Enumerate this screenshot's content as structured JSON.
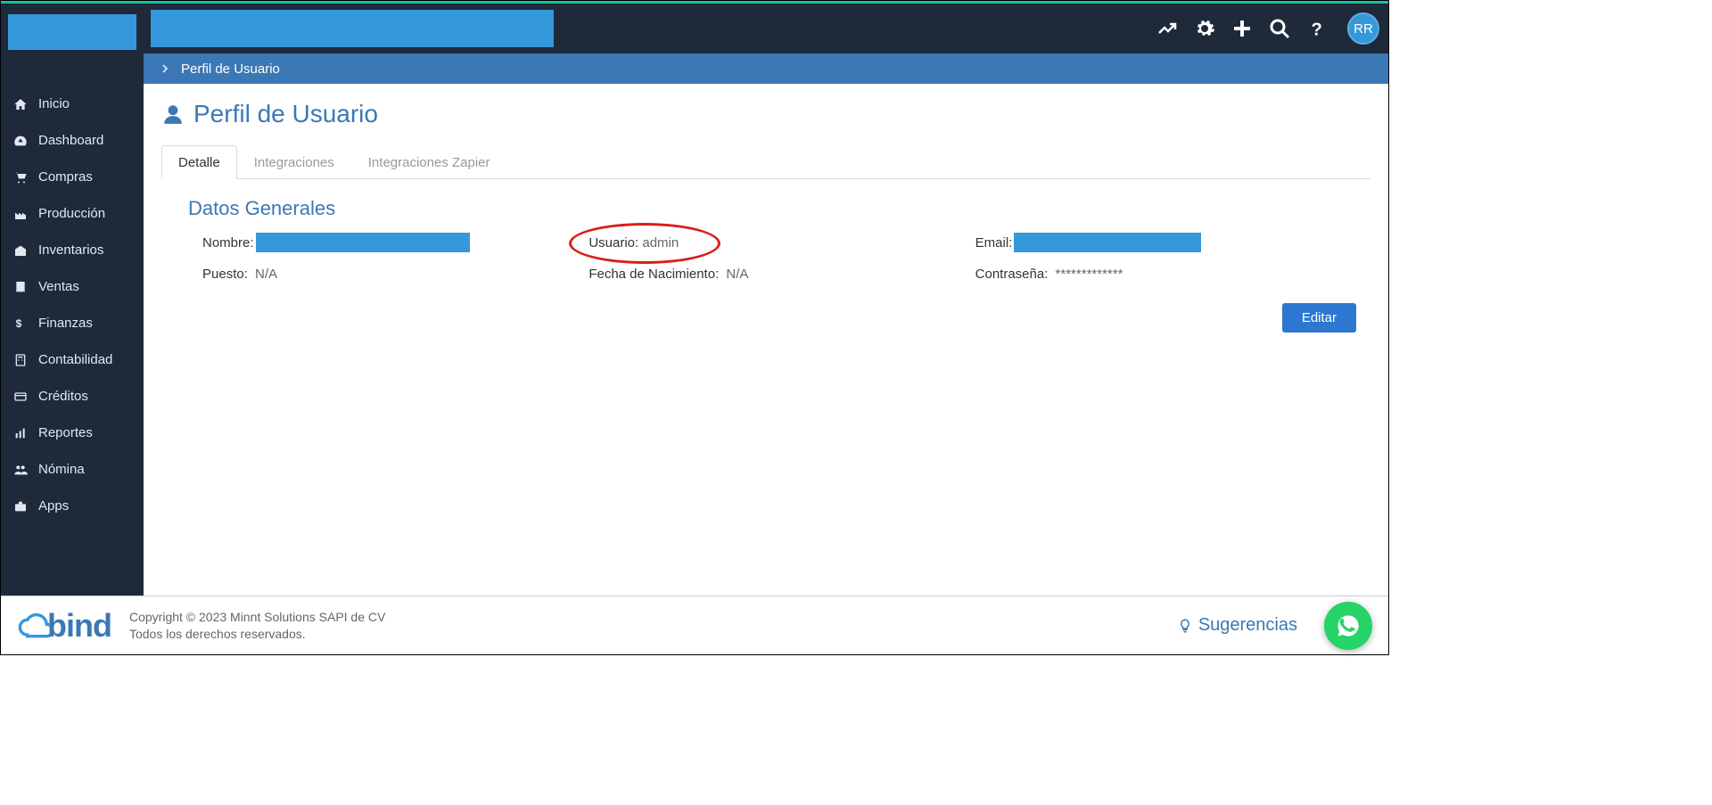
{
  "sidebar": {
    "items": [
      {
        "label": "Inicio"
      },
      {
        "label": "Dashboard"
      },
      {
        "label": "Compras"
      },
      {
        "label": "Producción"
      },
      {
        "label": "Inventarios"
      },
      {
        "label": "Ventas"
      },
      {
        "label": "Finanzas"
      },
      {
        "label": "Contabilidad"
      },
      {
        "label": "Créditos"
      },
      {
        "label": "Reportes"
      },
      {
        "label": "Nómina"
      },
      {
        "label": "Apps"
      }
    ]
  },
  "header": {
    "avatar_initials": "RR"
  },
  "breadcrumb": {
    "current": "Perfil de Usuario"
  },
  "page": {
    "title": "Perfil de Usuario",
    "section_title": "Datos Generales",
    "tabs": [
      {
        "label": "Detalle"
      },
      {
        "label": "Integraciones"
      },
      {
        "label": "Integraciones Zapier"
      }
    ],
    "fields": {
      "nombre_label": "Nombre:",
      "usuario_label": "Usuario:",
      "usuario_value": "admin",
      "email_label": "Email:",
      "puesto_label": "Puesto:",
      "puesto_value": "N/A",
      "fecha_label": "Fecha de Nacimiento:",
      "fecha_value": "N/A",
      "contrasena_label": "Contraseña:",
      "contrasena_value": "*************"
    },
    "edit_button": "Editar"
  },
  "footer": {
    "brand": "bind",
    "copyright": "Copyright © 2023 Minnt Solutions SAPI de CV",
    "rights": "Todos los derechos reservados.",
    "suggestions": "Sugerencias"
  }
}
